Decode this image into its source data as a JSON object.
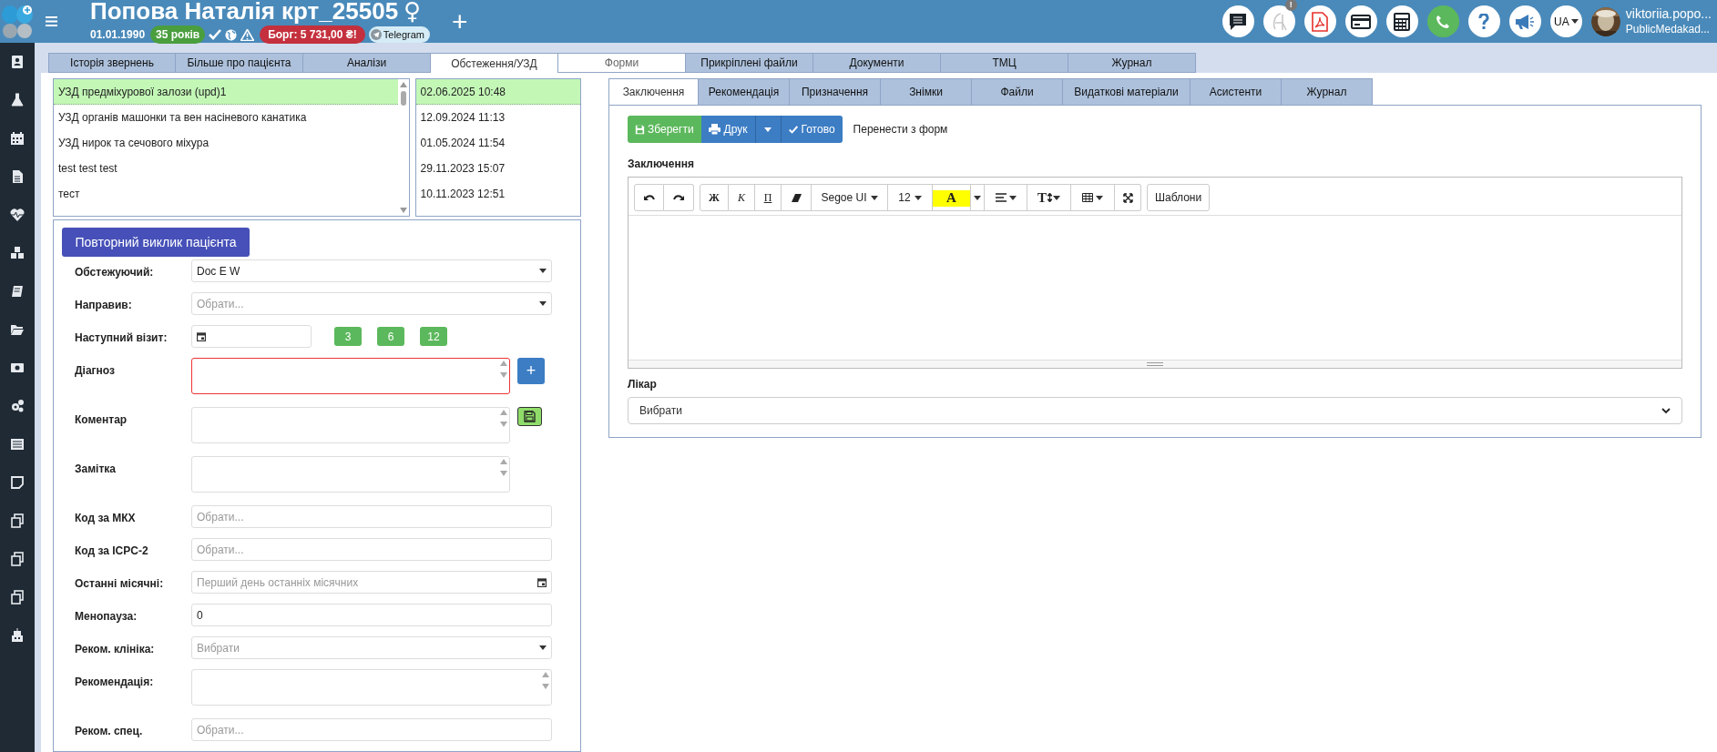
{
  "header": {
    "patient_name": "Попова Наталія крт_25505",
    "gender_symbol": "♀",
    "birth_date": "01.01.1990",
    "age_badge": "35 років",
    "debt_badge": "Борг: 5 731,00 ₴!",
    "messenger_badge": "Telegram",
    "add_symbol": "+",
    "notification_badge": "!",
    "language": "UA",
    "user_name": "viktoriia.popo...",
    "organization": "PublicMedakad..."
  },
  "main_tabs": [
    {
      "label": "Історія звернень",
      "selected": false,
      "hovered": false
    },
    {
      "label": "Більше про пацієнта",
      "selected": false,
      "hovered": false
    },
    {
      "label": "Аналізи",
      "selected": false,
      "hovered": false
    },
    {
      "label": "Обстеження/УЗД",
      "selected": true,
      "hovered": false
    },
    {
      "label": "Форми",
      "selected": false,
      "hovered": true
    },
    {
      "label": "Прикріплені файли",
      "selected": false,
      "hovered": false
    },
    {
      "label": "Документи",
      "selected": false,
      "hovered": false
    },
    {
      "label": "ТМЦ",
      "selected": false,
      "hovered": false
    },
    {
      "label": "Журнал",
      "selected": false,
      "hovered": false
    }
  ],
  "exams": [
    {
      "name": "УЗД предміхурової залози (upd)1",
      "date": "02.06.2025 10:48",
      "selected": true
    },
    {
      "name": "УЗД органів машонки та вен насіневого канатика",
      "date": "12.09.2024 11:13",
      "selected": false
    },
    {
      "name": "УЗД нирок та сечового міхура",
      "date": "01.05.2024 11:54",
      "selected": false
    },
    {
      "name": "test test test",
      "date": "29.11.2023 15:07",
      "selected": false
    },
    {
      "name": "тест",
      "date": "10.11.2023 12:51",
      "selected": false
    }
  ],
  "repeat_call_button": "Повторний виклик пацієнта",
  "form_fields": [
    {
      "label": "Обстежуючий:",
      "kind": "select",
      "value": "Doc E W"
    },
    {
      "label": "Направив:",
      "kind": "select",
      "placeholder": "Обрати..."
    },
    {
      "label": "Наступний візит:",
      "kind": "date",
      "quick_buttons": [
        "3",
        "6",
        "12"
      ]
    },
    {
      "label": "Діагноз",
      "kind": "textarea",
      "invalid": true,
      "side_button": {
        "kind": "add",
        "label": "+"
      }
    },
    {
      "label": "Коментар",
      "kind": "textarea",
      "invalid": false,
      "side_button": {
        "kind": "save"
      }
    },
    {
      "label": "Замітка",
      "kind": "textarea",
      "invalid": false
    },
    {
      "label": "Код за МКХ",
      "kind": "text",
      "placeholder": "Обрати..."
    },
    {
      "label": "Код за ICPC-2",
      "kind": "text",
      "placeholder": "Обрати..."
    },
    {
      "label": "Останні місячні:",
      "kind": "date",
      "placeholder": "Перший день останніх місячних"
    },
    {
      "label": "Менопауза:",
      "kind": "text",
      "value": "0"
    },
    {
      "label": "Реком. клініка:",
      "kind": "select",
      "placeholder": "Вибрати"
    },
    {
      "label": "Рекомендація:",
      "kind": "textarea",
      "invalid": false,
      "wide": true
    },
    {
      "label": "Реком. спец.",
      "kind": "text",
      "placeholder": "Обрати..."
    }
  ],
  "sub_tabs": [
    {
      "label": "Заключення",
      "selected": true
    },
    {
      "label": "Рекомендація",
      "selected": false
    },
    {
      "label": "Призначення",
      "selected": false
    },
    {
      "label": "Знімки",
      "selected": false
    },
    {
      "label": "Файли",
      "selected": false
    },
    {
      "label": "Видаткові матеріали",
      "selected": false
    },
    {
      "label": "Асистенти",
      "selected": false
    },
    {
      "label": "Журнал",
      "selected": false
    }
  ],
  "actions": {
    "save": "Зберегти",
    "print": "Друк",
    "done": "Готово",
    "transfer_link": "Перенести з форм"
  },
  "conclusion_label": "Заключення",
  "editor": {
    "bold": "Ж",
    "italic": "К",
    "underline": "П",
    "font": "Segoe UI",
    "size": "12",
    "color_letter": "A",
    "line_height_letter": "T",
    "templates": "Шаблони"
  },
  "doctor": {
    "label": "Лікар",
    "value": "Вибрати"
  }
}
